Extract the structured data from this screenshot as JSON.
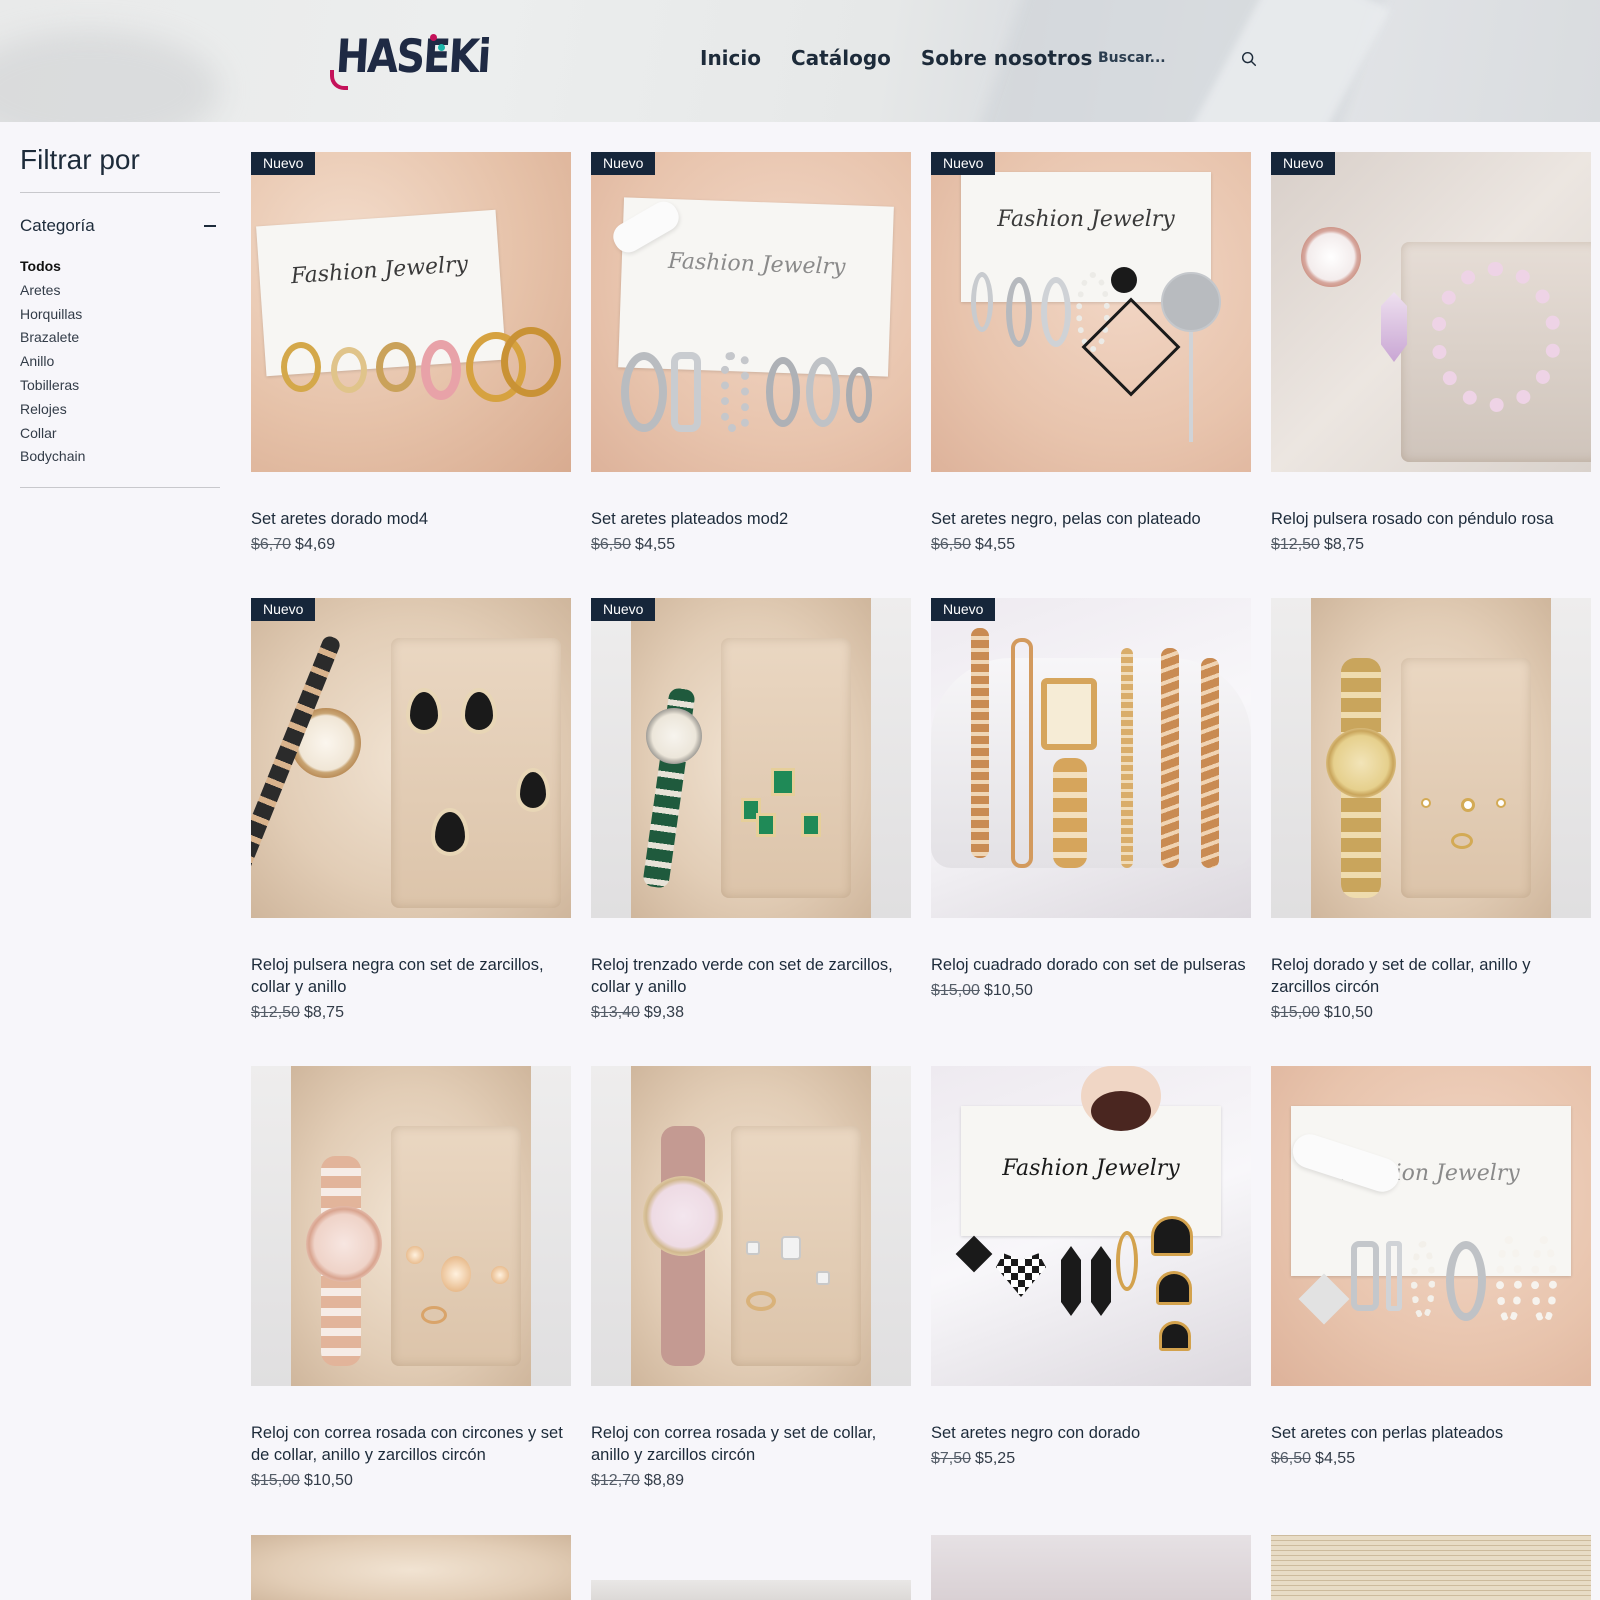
{
  "header": {
    "logo_text": "HASEKi",
    "nav": [
      "Inicio",
      "Catálogo",
      "Sobre nosotros"
    ],
    "search": {
      "placeholder": "Buscar..."
    }
  },
  "sidebar": {
    "title": "Filtrar por",
    "category_label": "Categoría",
    "categories": [
      "Todos",
      "Aretes",
      "Horquillas",
      "Brazalete",
      "Anillo",
      "Tobilleras",
      "Relojes",
      "Collar",
      "Bodychain"
    ],
    "active_category": "Todos"
  },
  "badge_label": "Nuevo",
  "image_script_text": "Fashion Jewelry",
  "products": [
    {
      "title": "Set aretes dorado mod4",
      "old_price": "$6,70",
      "price": "$4,69",
      "badge": true
    },
    {
      "title": "Set aretes plateados mod2",
      "old_price": "$6,50",
      "price": "$4,55",
      "badge": true
    },
    {
      "title": "Set aretes negro, pelas con plateado",
      "old_price": "$6,50",
      "price": "$4,55",
      "badge": true
    },
    {
      "title": "Reloj pulsera rosado con péndulo rosa",
      "old_price": "$12,50",
      "price": "$8,75",
      "badge": true
    },
    {
      "title": "Reloj pulsera negra con set de zarcillos, collar y anillo",
      "old_price": "$12,50",
      "price": "$8,75",
      "badge": true
    },
    {
      "title": "Reloj trenzado verde con set de zarcillos, collar y anillo",
      "old_price": "$13,40",
      "price": "$9,38",
      "badge": true
    },
    {
      "title": "Reloj cuadrado dorado con set de pulseras",
      "old_price": "$15,00",
      "price": "$10,50",
      "badge": true
    },
    {
      "title": "Reloj dorado y set de collar, anillo y zarcillos circón",
      "old_price": "$15,00",
      "price": "$10,50",
      "badge": false
    },
    {
      "title": "Reloj con correa rosada con circones y set de collar, anillo y zarcillos circón",
      "old_price": "$15,00",
      "price": "$10,50",
      "badge": false
    },
    {
      "title": "Reloj con correa rosada y set de collar, anillo y zarcillos circón",
      "old_price": "$12,70",
      "price": "$8,89",
      "badge": false
    },
    {
      "title": "Set aretes negro con dorado",
      "old_price": "$7,50",
      "price": "$5,25",
      "badge": false
    },
    {
      "title": "Set aretes con perlas plateados",
      "old_price": "$6,50",
      "price": "$4,55",
      "badge": false
    }
  ]
}
